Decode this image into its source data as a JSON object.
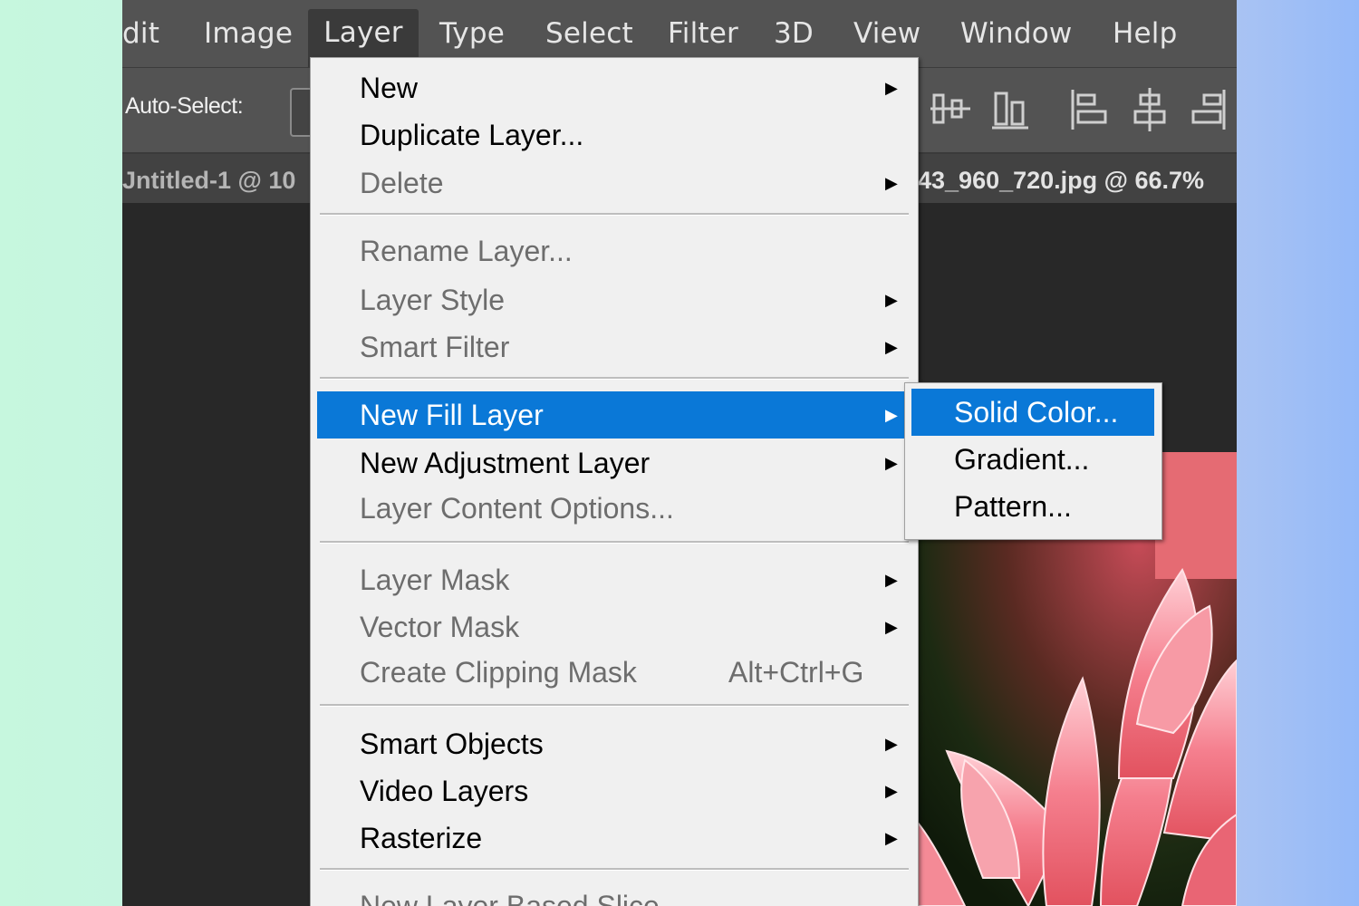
{
  "menubar": {
    "items": [
      {
        "label": "dit"
      },
      {
        "label": "Image"
      },
      {
        "label": "Layer"
      },
      {
        "label": "Type"
      },
      {
        "label": "Select"
      },
      {
        "label": "Filter"
      },
      {
        "label": "3D"
      },
      {
        "label": "View"
      },
      {
        "label": "Window"
      },
      {
        "label": "Help"
      }
    ],
    "active": "Layer"
  },
  "options_bar": {
    "auto_select_label": "Auto-Select:"
  },
  "document_tabs": [
    {
      "label": "Jntitled-1 @ 10"
    },
    {
      "label": "43_960_720.jpg @ 66.7%"
    }
  ],
  "layer_menu": {
    "items": [
      {
        "label": "New",
        "submenu": true,
        "enabled": true
      },
      {
        "label": "Duplicate Layer...",
        "submenu": false,
        "enabled": true
      },
      {
        "label": "Delete",
        "submenu": true,
        "enabled": false
      },
      {
        "label": "Rename Layer...",
        "submenu": false,
        "enabled": false
      },
      {
        "label": "Layer Style",
        "submenu": true,
        "enabled": false
      },
      {
        "label": "Smart Filter",
        "submenu": true,
        "enabled": false
      },
      {
        "label": "New Fill Layer",
        "submenu": true,
        "enabled": true,
        "highlighted": true
      },
      {
        "label": "New Adjustment Layer",
        "submenu": true,
        "enabled": true
      },
      {
        "label": "Layer Content Options...",
        "submenu": false,
        "enabled": false
      },
      {
        "label": "Layer Mask",
        "submenu": true,
        "enabled": false
      },
      {
        "label": "Vector Mask",
        "submenu": true,
        "enabled": false
      },
      {
        "label": "Create Clipping Mask",
        "shortcut": "Alt+Ctrl+G",
        "submenu": false,
        "enabled": false
      },
      {
        "label": "Smart Objects",
        "submenu": true,
        "enabled": true
      },
      {
        "label": "Video Layers",
        "submenu": true,
        "enabled": true
      },
      {
        "label": "Rasterize",
        "submenu": true,
        "enabled": true
      },
      {
        "label": "New Layer Based Slice",
        "submenu": false,
        "enabled": false
      }
    ],
    "arrow_glyph": "▶"
  },
  "fill_submenu": {
    "items": [
      {
        "label": "Solid Color...",
        "highlighted": true
      },
      {
        "label": "Gradient..."
      },
      {
        "label": "Pattern..."
      }
    ]
  },
  "colors": {
    "highlight": "#0a78d7",
    "menu_bg": "#f0f0f0",
    "app_bg": "#282828",
    "menubar_bg": "#535353"
  }
}
